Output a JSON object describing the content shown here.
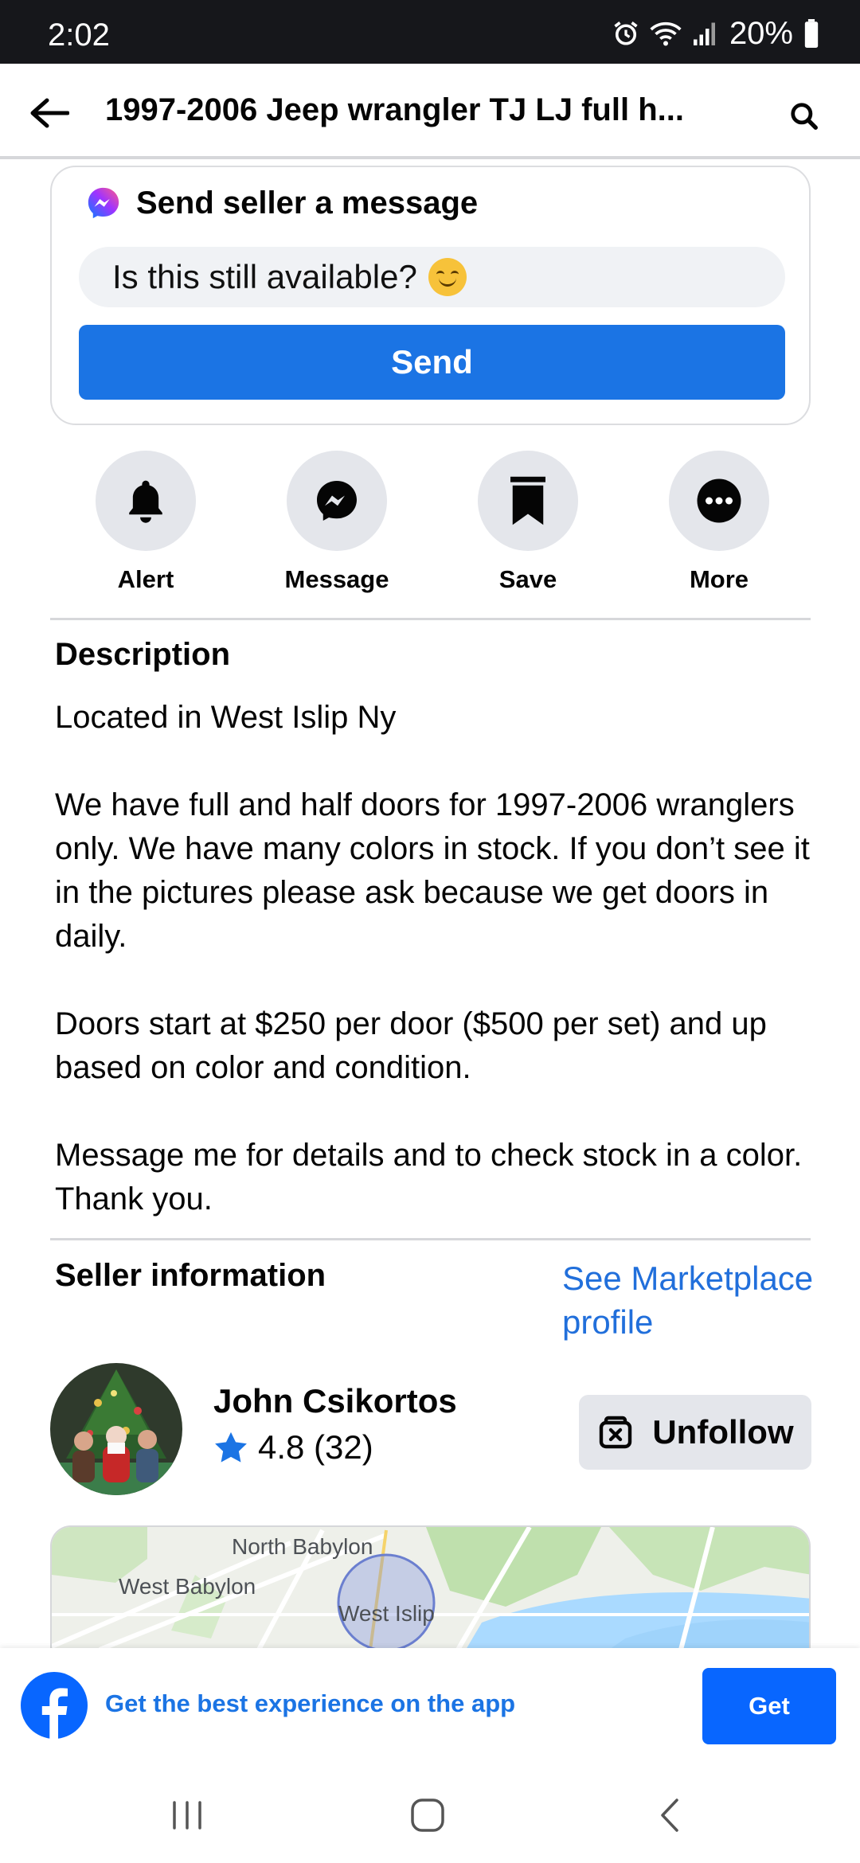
{
  "status_bar": {
    "time": "2:02",
    "battery": "20%"
  },
  "header": {
    "title": "1997-2006 Jeep wrangler TJ LJ full h..."
  },
  "message_card": {
    "heading": "Send seller a message",
    "input_value": "Is this still available?",
    "send_label": "Send"
  },
  "actions": [
    {
      "label": "Alert",
      "icon": "bell-icon"
    },
    {
      "label": "Message",
      "icon": "messenger-icon"
    },
    {
      "label": "Save",
      "icon": "bookmark-icon"
    },
    {
      "label": "More",
      "icon": "more-icon"
    }
  ],
  "description": {
    "title": "Description",
    "paragraphs": [
      "Located in West Islip Ny",
      "We have full and half doors for 1997-2006 wranglers only. We have many colors in stock. If you don’t see it in the pictures please ask because we get doors in daily.",
      "Doors start at $250 per door ($500 per set) and up based on color and condition.",
      "Message me for details and to check stock in a color. Thank you."
    ]
  },
  "seller": {
    "title": "Seller information",
    "profile_link": "See Marketplace profile",
    "name": "John Csikortos",
    "rating": "4.8 (32)",
    "unfollow_label": "Unfollow"
  },
  "map": {
    "labels": [
      "North Babylon",
      "West Babylon",
      "West Islip"
    ]
  },
  "app_banner": {
    "text": "Get the best experience on the app",
    "button": "Get"
  },
  "colors": {
    "primary_blue": "#1b74e4",
    "link_blue": "#216fdb",
    "chip_gray": "#e4e6eb",
    "status_bar": "#16171b"
  }
}
